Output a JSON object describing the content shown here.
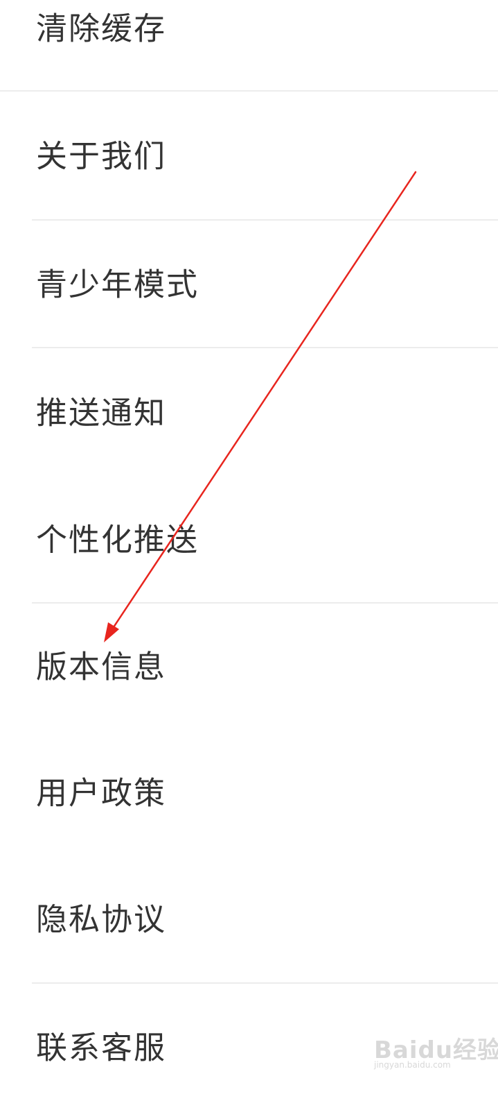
{
  "settings": {
    "items": [
      {
        "label": "清除缓存"
      },
      {
        "label": "关于我们"
      },
      {
        "label": "青少年模式"
      },
      {
        "label": "推送通知"
      },
      {
        "label": "个性化推送"
      },
      {
        "label": "版本信息"
      },
      {
        "label": "用户政策"
      },
      {
        "label": "隐私协议"
      },
      {
        "label": "联系客服"
      }
    ]
  },
  "colors": {
    "text": "#333333",
    "divider": "#ececec",
    "arrow": "#e8251e",
    "background": "#ffffff"
  },
  "watermark": {
    "text": "Baidu经验",
    "sub": "jingyan.baidu.com"
  }
}
